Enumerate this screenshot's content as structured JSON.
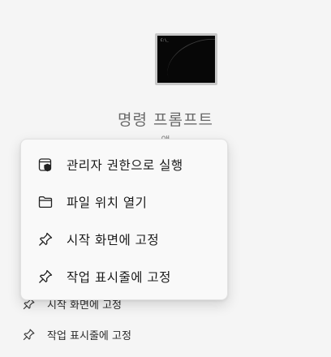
{
  "app": {
    "name": "명령 프롬프트",
    "kind": "앱",
    "icon": "command-prompt-icon",
    "icon_prompt_text": "C:\\_"
  },
  "background_list": [
    {
      "label": "시작 화면에 고정",
      "icon": "pin-icon"
    },
    {
      "label": "작업 표시줄에 고정",
      "icon": "pin-icon"
    }
  ],
  "context_menu": {
    "items": [
      {
        "label": "관리자 권한으로 실행",
        "icon": "shield-app-icon"
      },
      {
        "label": "파일 위치 열기",
        "icon": "folder-icon"
      },
      {
        "label": "시작 화면에 고정",
        "icon": "pin-icon"
      },
      {
        "label": "작업 표시줄에 고정",
        "icon": "pin-icon"
      }
    ]
  }
}
